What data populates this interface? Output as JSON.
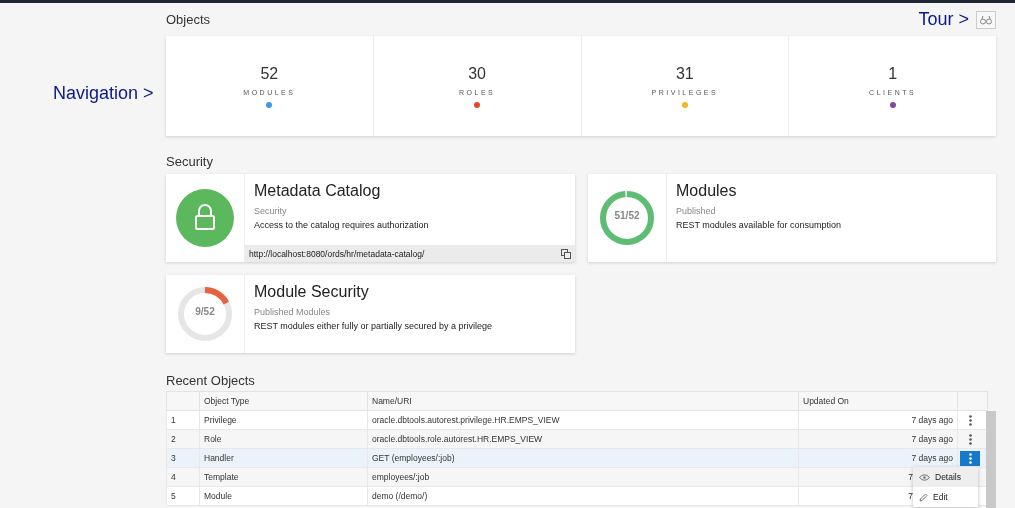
{
  "navigation": {
    "label": "Navigation >"
  },
  "tour": {
    "label": "Tour >"
  },
  "objects": {
    "title": "Objects",
    "stats": [
      {
        "value": "52",
        "label": "MODULES",
        "color": "#3a9be6"
      },
      {
        "value": "30",
        "label": "ROLES",
        "color": "#e8472a"
      },
      {
        "value": "31",
        "label": "PRIVILEGES",
        "color": "#f5b623"
      },
      {
        "value": "1",
        "label": "CLIENTS",
        "color": "#7d4a9c"
      }
    ]
  },
  "security": {
    "title": "Security",
    "cards": [
      {
        "kind": "lock",
        "title": "Metadata Catalog",
        "subtitle": "Security",
        "description": "Access to the catalog requires authorization",
        "url": "http://localhost:8080/ords/hr/metadata-catalog/"
      },
      {
        "kind": "donut",
        "title": "Modules",
        "subtitle": "Published",
        "description": "REST modules available for consumption",
        "reading": "51/52",
        "level": 0.981,
        "color": "#5dbe73"
      },
      {
        "kind": "donut",
        "title": "Module Security",
        "subtitle": "Published Modules",
        "description": "REST modules either fully or partially secured by a privilege",
        "reading": "9/52",
        "level": 0.173,
        "color": "#e8613f"
      }
    ]
  },
  "recent": {
    "title": "Recent Objects",
    "columns": [
      "Object Type",
      "Name/URI",
      "Updated On"
    ],
    "rows": [
      {
        "index": "1",
        "type": "Privilege",
        "name": "oracle.dbtools.autorest.privilege.HR.EMPS_VIEW",
        "updated": "7 days ago",
        "selected": false
      },
      {
        "index": "2",
        "type": "Role",
        "name": "oracle.dbtools.role.autorest.HR.EMPS_VIEW",
        "updated": "7 days ago",
        "selected": false
      },
      {
        "index": "3",
        "type": "Handler",
        "name": "GET (employees/:job)",
        "updated": "7 days ago",
        "selected": true
      },
      {
        "index": "4",
        "type": "Template",
        "name": "employees/:job",
        "updated": "7",
        "selected": false
      },
      {
        "index": "5",
        "type": "Module",
        "name": "demo (/demo/)",
        "updated": "7",
        "selected": false
      }
    ],
    "menu": [
      {
        "kind": "eye",
        "label": "Details",
        "selected": true
      },
      {
        "kind": "pencil",
        "label": "Edit",
        "selected": false
      }
    ]
  }
}
